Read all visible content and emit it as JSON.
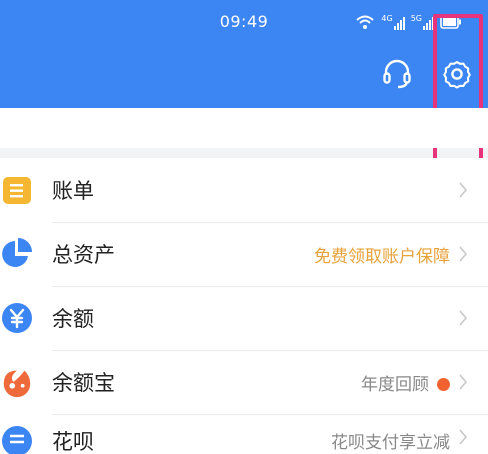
{
  "status_bar": {
    "time": "09:49",
    "net1": "4G",
    "net2": "5G"
  },
  "header": {
    "icons": [
      "headset-icon",
      "gear-icon"
    ]
  },
  "list": [
    {
      "label": "账单",
      "icon": "bill-icon",
      "extra": ""
    },
    {
      "label": "总资产",
      "icon": "pie-chart-icon",
      "extra": "免费领取账户保障"
    },
    {
      "label": "余额",
      "icon": "yuan-icon",
      "extra": ""
    },
    {
      "label": "余额宝",
      "icon": "yuebao-icon",
      "extra": "年度回顾"
    },
    {
      "label": "花呗",
      "icon": "huabei-icon",
      "extra": "花呗支付享立减"
    }
  ],
  "colors": {
    "brand": "#3c86f4",
    "accent_orange": "#e8a23a",
    "highlight": "#e6337a"
  }
}
